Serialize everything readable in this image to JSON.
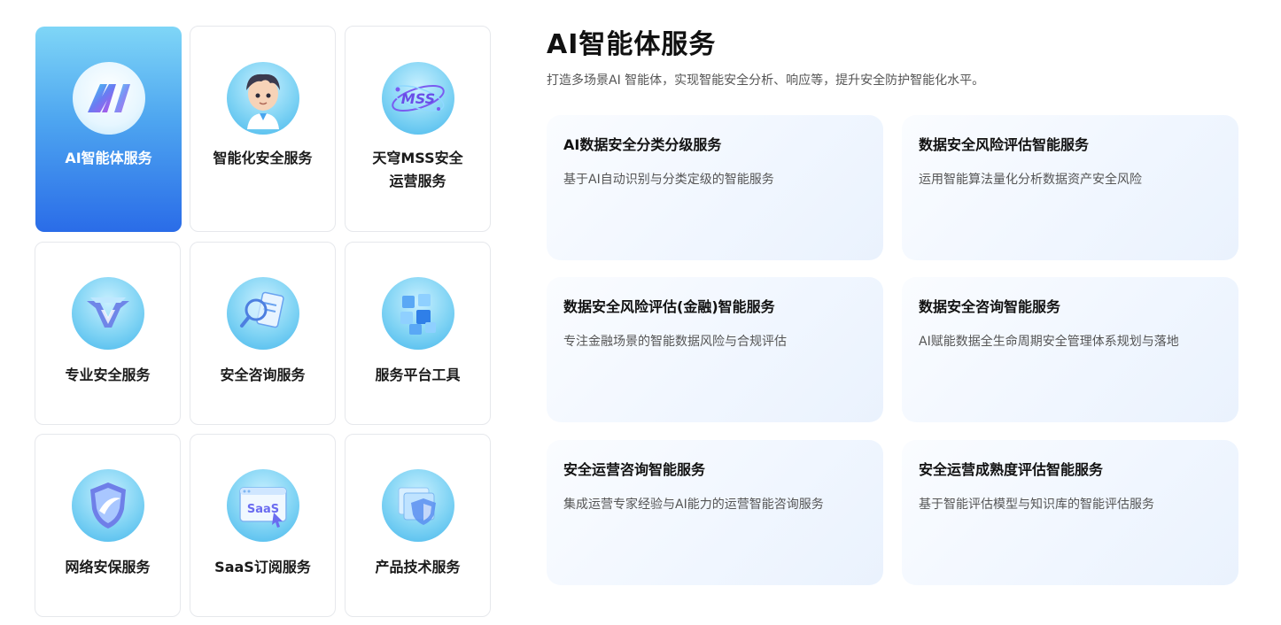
{
  "tiles": [
    {
      "label": "AI智能体服务",
      "icon": "ai-agent-icon",
      "active": true
    },
    {
      "label": "智能化安全服务",
      "icon": "avatar-icon",
      "active": false
    },
    {
      "label": "天穹MSS安全运营服务",
      "icon": "mss-icon",
      "active": false
    },
    {
      "label": "专业安全服务",
      "icon": "shield-wings-icon",
      "active": false
    },
    {
      "label": "安全咨询服务",
      "icon": "magnifier-document-icon",
      "active": false
    },
    {
      "label": "服务平台工具",
      "icon": "cubes-icon",
      "active": false
    },
    {
      "label": "网络安保服务",
      "icon": "shield-icon",
      "active": false
    },
    {
      "label": "SaaS订阅服务",
      "icon": "saas-window-icon",
      "active": false
    },
    {
      "label": "产品技术服务",
      "icon": "layered-shield-icon",
      "active": false
    }
  ],
  "tile_label_lines": {
    "mss_line1": "天穹MSS安全",
    "mss_line2": "运营服务"
  },
  "header": {
    "title": "AI智能体服务",
    "subtitle": "打造多场景AI 智能体，实现智能安全分析、响应等，提升安全防护智能化水平。"
  },
  "saas_icon_text": "SaaS",
  "mss_icon_text": "MSS",
  "cards": [
    {
      "title": "AI数据安全分类分级服务",
      "desc": "基于AI自动识别与分类定级的智能服务"
    },
    {
      "title": "数据安全风险评估智能服务",
      "desc": "运用智能算法量化分析数据资产安全风险"
    },
    {
      "title": "数据安全风险评估(金融)智能服务",
      "desc": "专注金融场景的智能数据风险与合规评估"
    },
    {
      "title": "数据安全咨询智能服务",
      "desc": "AI赋能数据全生命周期安全管理体系规划与落地"
    },
    {
      "title": "安全运营咨询智能服务",
      "desc": "集成运营专家经验与AI能力的运营智能咨询服务"
    },
    {
      "title": "安全运营成熟度评估智能服务",
      "desc": "基于智能评估模型与知识库的智能评估服务"
    }
  ],
  "colors": {
    "accent": "#2a6ce8",
    "accent_light": "#7fd6f7",
    "card_bg": "#f0f6ff"
  }
}
